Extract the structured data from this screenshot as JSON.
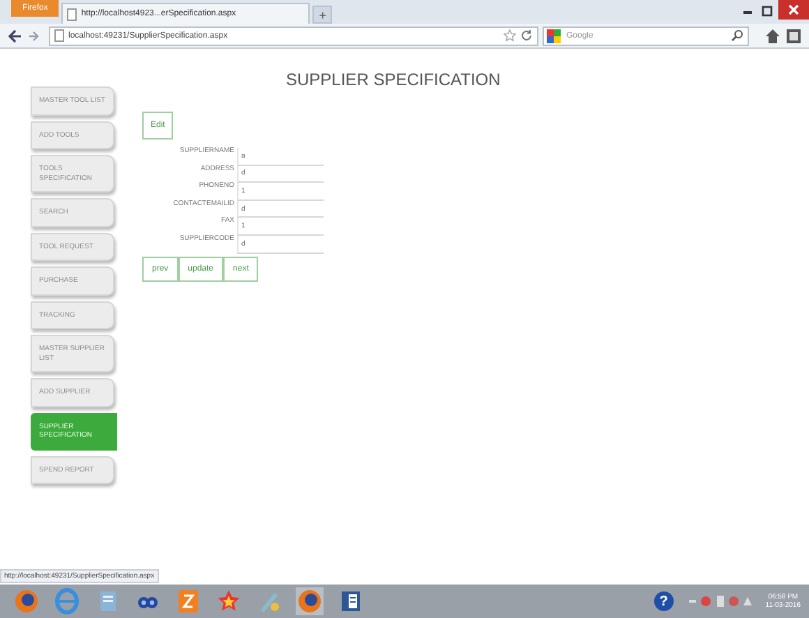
{
  "browser": {
    "menu_button": "Firefox",
    "tab_title": "http://localhost4923...erSpecification.aspx",
    "new_tab": "+",
    "address": "localhost:49231/SupplierSpecification.aspx",
    "search_placeholder": "Google"
  },
  "sidebar": {
    "items": [
      {
        "label": "MASTER TOOL LIST",
        "selected": false
      },
      {
        "label": "ADD TOOLS",
        "selected": false
      },
      {
        "label": "TOOLS SPECIFICATION",
        "selected": false
      },
      {
        "label": "SEARCH",
        "selected": false
      },
      {
        "label": "TOOL REQUEST",
        "selected": false
      },
      {
        "label": "PURCHASE",
        "selected": false
      },
      {
        "label": "TRACKING",
        "selected": false
      },
      {
        "label": "MASTER SUPPLIER LIST",
        "selected": false
      },
      {
        "label": "ADD SUPPLIER",
        "selected": false
      },
      {
        "label": "SUPPLIER SPECIFICATION",
        "selected": true
      },
      {
        "label": "SPEND REPORT",
        "selected": false
      }
    ]
  },
  "page": {
    "title": "SUPPLIER SPECIFICATION",
    "edit_button": "Edit",
    "fields": [
      {
        "label": "SUPPLIERNAME",
        "value": "a"
      },
      {
        "label": "ADDRESS",
        "value": "d"
      },
      {
        "label": "PHONENO",
        "value": "1"
      },
      {
        "label": "CONTACTEMAILID",
        "value": "d"
      },
      {
        "label": "FAX",
        "value": "1"
      },
      {
        "label": "SUPPLIERCODE",
        "value": "d"
      }
    ],
    "buttons": [
      "prev",
      "update",
      "next"
    ]
  },
  "status_bar": {
    "link": "http://localhost:49231/SupplierSpecification.aspx"
  },
  "taskbar": {
    "time": "06:58 PM",
    "date": "11-03-2016",
    "help": "?"
  }
}
